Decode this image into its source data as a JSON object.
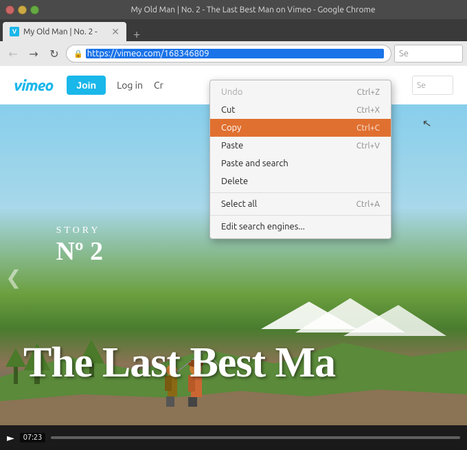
{
  "titlebar": {
    "title": "My Old Man | No. 2 - The Last Best Man on Vimeo - Google Chrome"
  },
  "tab": {
    "label": "My Old Man | No. 2 -",
    "favicon": "V"
  },
  "navbar": {
    "url": "https://vimeo.com/168346809",
    "search_placeholder": "Se"
  },
  "vimeo": {
    "logo": "vimeo",
    "join_label": "Join",
    "login_label": "Log in",
    "cr_label": "Cr"
  },
  "context_menu": {
    "items": [
      {
        "label": "Undo",
        "shortcut": "Ctrl+Z",
        "active": false,
        "disabled": true
      },
      {
        "label": "Cut",
        "shortcut": "Ctrl+X",
        "active": false,
        "disabled": false
      },
      {
        "label": "Copy",
        "shortcut": "Ctrl+C",
        "active": true,
        "disabled": false
      },
      {
        "label": "Paste",
        "shortcut": "Ctrl+V",
        "active": false,
        "disabled": false
      },
      {
        "label": "Paste and search",
        "shortcut": "",
        "active": false,
        "disabled": false
      },
      {
        "label": "Delete",
        "shortcut": "",
        "active": false,
        "disabled": false
      },
      {
        "separator": true
      },
      {
        "label": "Select all",
        "shortcut": "Ctrl+A",
        "active": false,
        "disabled": false
      },
      {
        "separator": true
      },
      {
        "label": "Edit search engines...",
        "shortcut": "",
        "active": false,
        "disabled": false
      }
    ]
  },
  "video": {
    "story_word": "STORY",
    "story_n": "Nº 2",
    "title": "The Last Best Ma",
    "time": "07:23"
  }
}
